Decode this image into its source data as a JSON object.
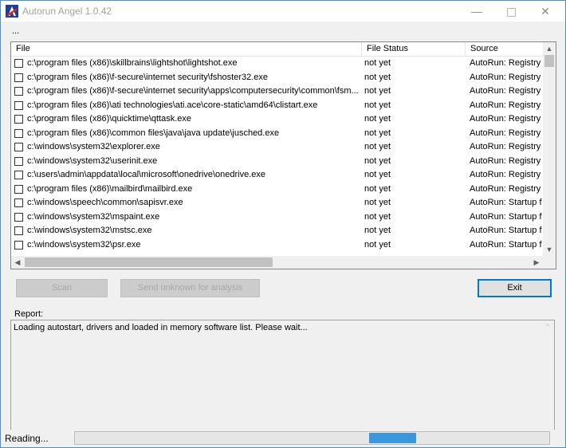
{
  "window": {
    "title": "Autorun Angel 1.0.42"
  },
  "toolbar": {
    "ellipsis": "..."
  },
  "table": {
    "columns": [
      "File",
      "File Status",
      "Source"
    ],
    "rows": [
      {
        "file": "c:\\program files (x86)\\skillbrains\\lightshot\\lightshot.exe",
        "status": "not yet",
        "source": "AutoRun: Registry"
      },
      {
        "file": "c:\\program files (x86)\\f-secure\\internet security\\fshoster32.exe",
        "status": "not yet",
        "source": "AutoRun: Registry"
      },
      {
        "file": "c:\\program files (x86)\\f-secure\\internet security\\apps\\computersecurity\\common\\fsm...",
        "status": "not yet",
        "source": "AutoRun: Registry"
      },
      {
        "file": "c:\\program files (x86)\\ati technologies\\ati.ace\\core-static\\amd64\\clistart.exe",
        "status": "not yet",
        "source": "AutoRun: Registry"
      },
      {
        "file": "c:\\program files (x86)\\quicktime\\qttask.exe",
        "status": "not yet",
        "source": "AutoRun: Registry"
      },
      {
        "file": "c:\\program files (x86)\\common files\\java\\java update\\jusched.exe",
        "status": "not yet",
        "source": "AutoRun: Registry"
      },
      {
        "file": "c:\\windows\\system32\\explorer.exe",
        "status": "not yet",
        "source": "AutoRun: Registry"
      },
      {
        "file": "c:\\windows\\system32\\userinit.exe",
        "status": "not yet",
        "source": "AutoRun: Registry"
      },
      {
        "file": "c:\\users\\admin\\appdata\\local\\microsoft\\onedrive\\onedrive.exe",
        "status": "not yet",
        "source": "AutoRun: Registry"
      },
      {
        "file": "c:\\program files (x86)\\mailbird\\mailbird.exe",
        "status": "not yet",
        "source": "AutoRun: Registry"
      },
      {
        "file": "c:\\windows\\speech\\common\\sapisvr.exe",
        "status": "not yet",
        "source": "AutoRun: Startup f"
      },
      {
        "file": "c:\\windows\\system32\\mspaint.exe",
        "status": "not yet",
        "source": "AutoRun: Startup f"
      },
      {
        "file": "c:\\windows\\system32\\mstsc.exe",
        "status": "not yet",
        "source": "AutoRun: Startup f"
      },
      {
        "file": "c:\\windows\\system32\\psr.exe",
        "status": "not yet",
        "source": "AutoRun: Startup f"
      }
    ]
  },
  "buttons": {
    "scan": "Scan",
    "send": "Send unknown for analysis",
    "exit": "Exit"
  },
  "report": {
    "label": "Report:",
    "text": "Loading autostart, drivers and loaded in memory software list. Please wait..."
  },
  "status": {
    "text": "Reading...",
    "progress_start": 0.62,
    "progress_end": 0.72
  },
  "colors": {
    "accent": "#0078d7",
    "progress": "#3a96dd"
  }
}
